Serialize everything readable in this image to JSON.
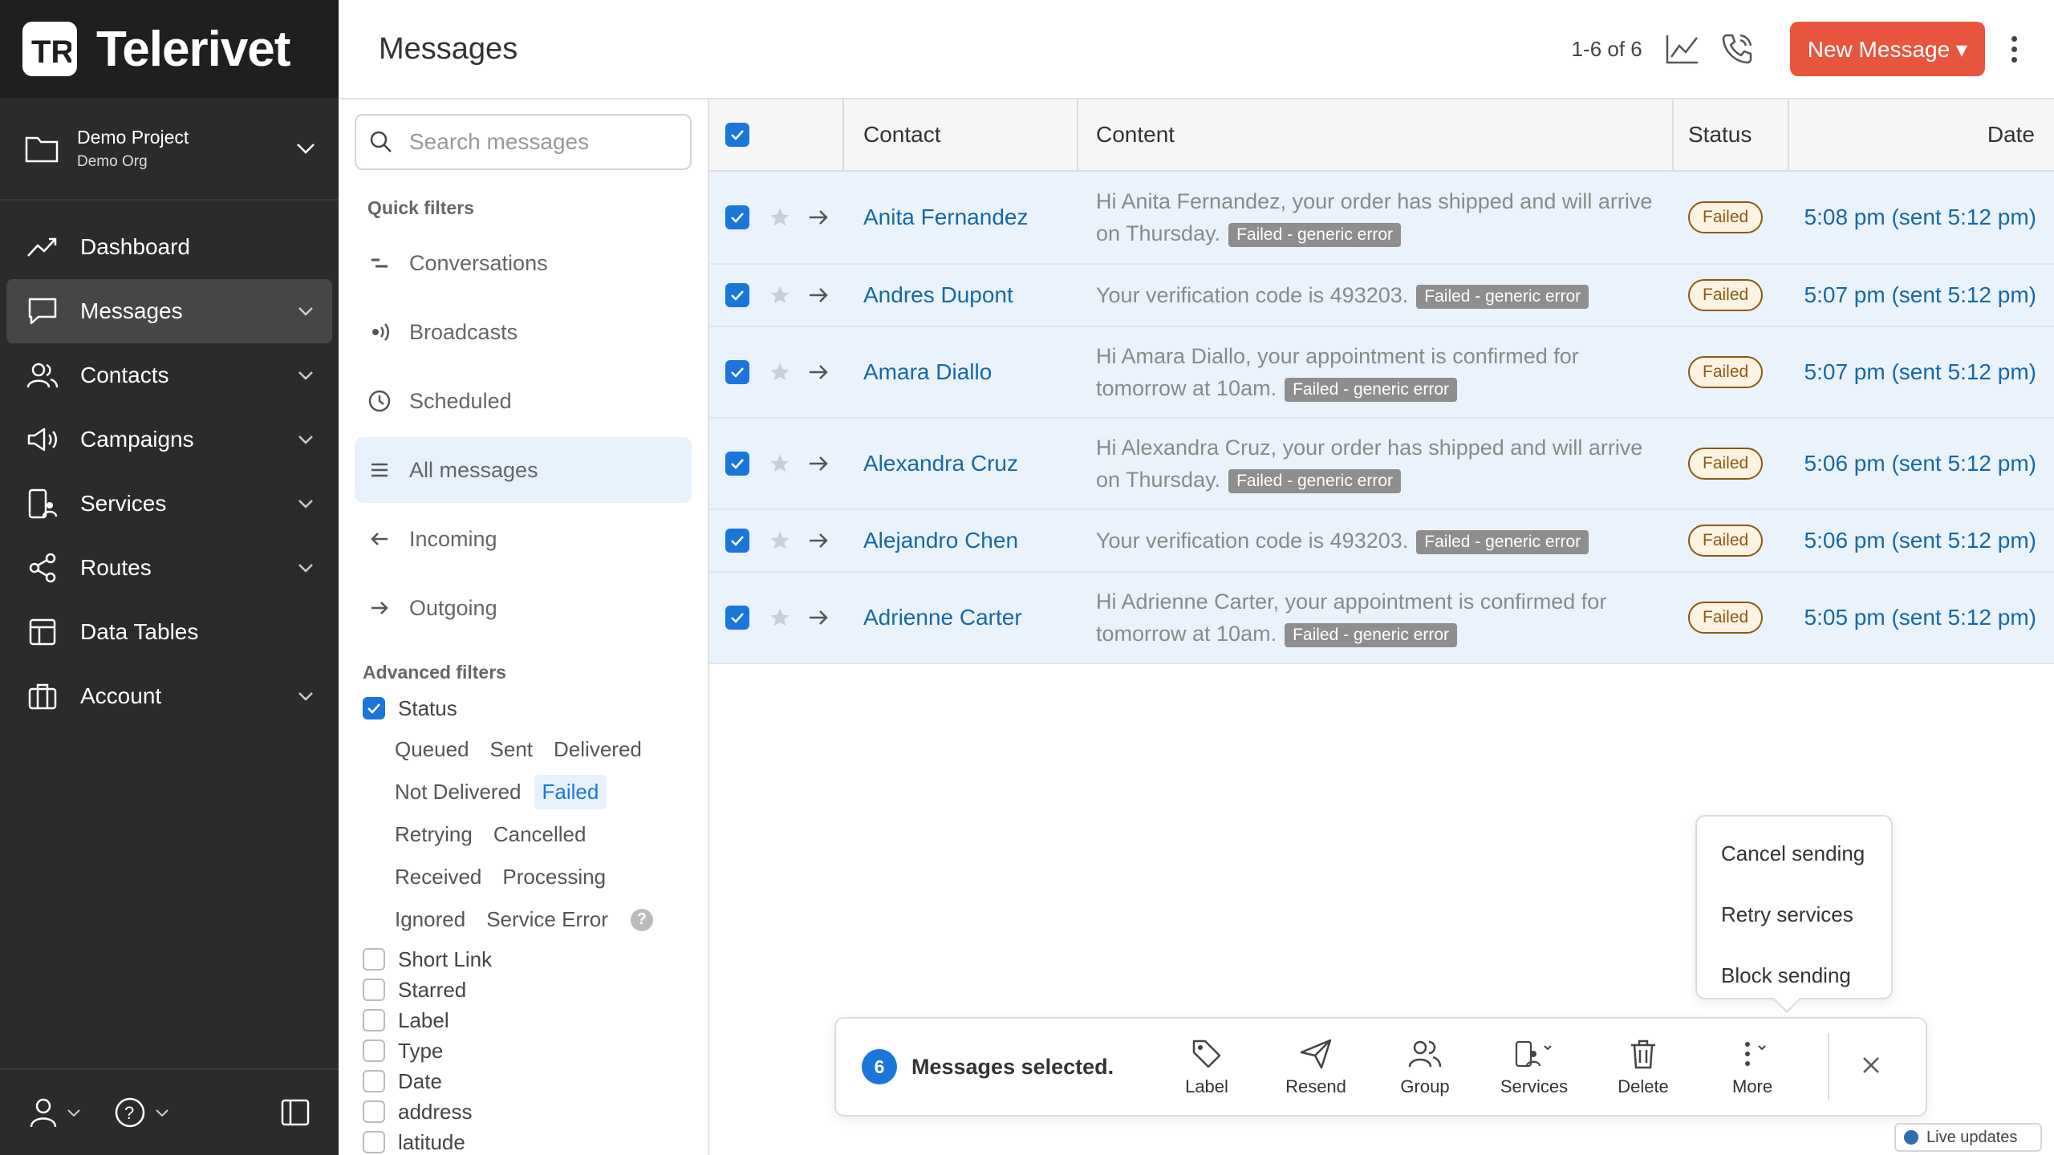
{
  "brand": {
    "name": "Telerivet",
    "logo_letters": "TR"
  },
  "project": {
    "name": "Demo Project",
    "org": "Demo Org"
  },
  "nav": {
    "items": [
      {
        "label": "Dashboard",
        "icon": "trend-icon"
      },
      {
        "label": "Messages",
        "icon": "chat-icon",
        "active": true
      },
      {
        "label": "Contacts",
        "icon": "people-icon"
      },
      {
        "label": "Campaigns",
        "icon": "megaphone-icon"
      },
      {
        "label": "Services",
        "icon": "services-icon"
      },
      {
        "label": "Routes",
        "icon": "share-icon"
      },
      {
        "label": "Data Tables",
        "icon": "table-icon"
      },
      {
        "label": "Account",
        "icon": "briefcase-icon"
      }
    ]
  },
  "header": {
    "title": "Messages",
    "pager": "1-6 of 6",
    "new_message": "New Message ▾"
  },
  "search": {
    "placeholder": "Search messages"
  },
  "quick_filters": {
    "title": "Quick filters",
    "items": [
      "Conversations",
      "Broadcasts",
      "Scheduled",
      "All messages",
      "Incoming",
      "Outgoing"
    ]
  },
  "advanced_filters": {
    "title": "Advanced filters",
    "status_label": "Status",
    "status_options": [
      [
        "Queued",
        "Sent",
        "Delivered"
      ],
      [
        "Not Delivered",
        "Failed"
      ],
      [
        "Retrying",
        "Cancelled"
      ],
      [
        "Received",
        "Processing"
      ],
      [
        "Ignored",
        "Service Error"
      ]
    ],
    "help": "?",
    "others": [
      "Short Link",
      "Starred",
      "Label",
      "Type",
      "Date",
      "address",
      "latitude"
    ]
  },
  "table": {
    "columns": {
      "contact": "Contact",
      "content": "Content",
      "status": "Status",
      "date": "Date"
    },
    "rows": [
      {
        "contact": "Anita Fernandez",
        "content": "Hi Anita Fernandez, your order has shipped and will arrive on Thursday.",
        "error": "Failed - generic error",
        "status": "Failed",
        "date": "5:08 pm (sent 5:12 pm)"
      },
      {
        "contact": "Andres Dupont",
        "content": "Your verification code is 493203.",
        "error": "Failed - generic error",
        "status": "Failed",
        "date": "5:07 pm (sent 5:12 pm)"
      },
      {
        "contact": "Amara Diallo",
        "content": "Hi Amara Diallo, your appointment is confirmed for tomorrow at 10am.",
        "error": "Failed - generic error",
        "status": "Failed",
        "date": "5:07 pm (sent 5:12 pm)"
      },
      {
        "contact": "Alexandra Cruz",
        "content": "Hi Alexandra Cruz, your order has shipped and will arrive on Thursday.",
        "error": "Failed - generic error",
        "status": "Failed",
        "date": "5:06 pm (sent 5:12 pm)"
      },
      {
        "contact": "Alejandro Chen",
        "content": "Your verification code is 493203.",
        "error": "Failed - generic error",
        "status": "Failed",
        "date": "5:06 pm (sent 5:12 pm)"
      },
      {
        "contact": "Adrienne Carter",
        "content": "Hi Adrienne Carter, your appointment is confirmed for tomorrow at 10am.",
        "error": "Failed - generic error",
        "status": "Failed",
        "date": "5:05 pm (sent 5:12 pm)"
      }
    ]
  },
  "more_menu": {
    "items": [
      "Cancel sending",
      "Retry services",
      "Block sending"
    ]
  },
  "action_bar": {
    "count": "6",
    "text": "Messages selected.",
    "actions": [
      "Label",
      "Resend",
      "Group",
      "Services",
      "Delete",
      "More"
    ]
  },
  "live_updates": "Live updates",
  "colors": {
    "accent": "#1b76dc",
    "brand_button": "#e8553e",
    "nav_bg": "#2b2b2b",
    "row_bg": "#eaf3fb",
    "failed": "#8a5a12"
  }
}
